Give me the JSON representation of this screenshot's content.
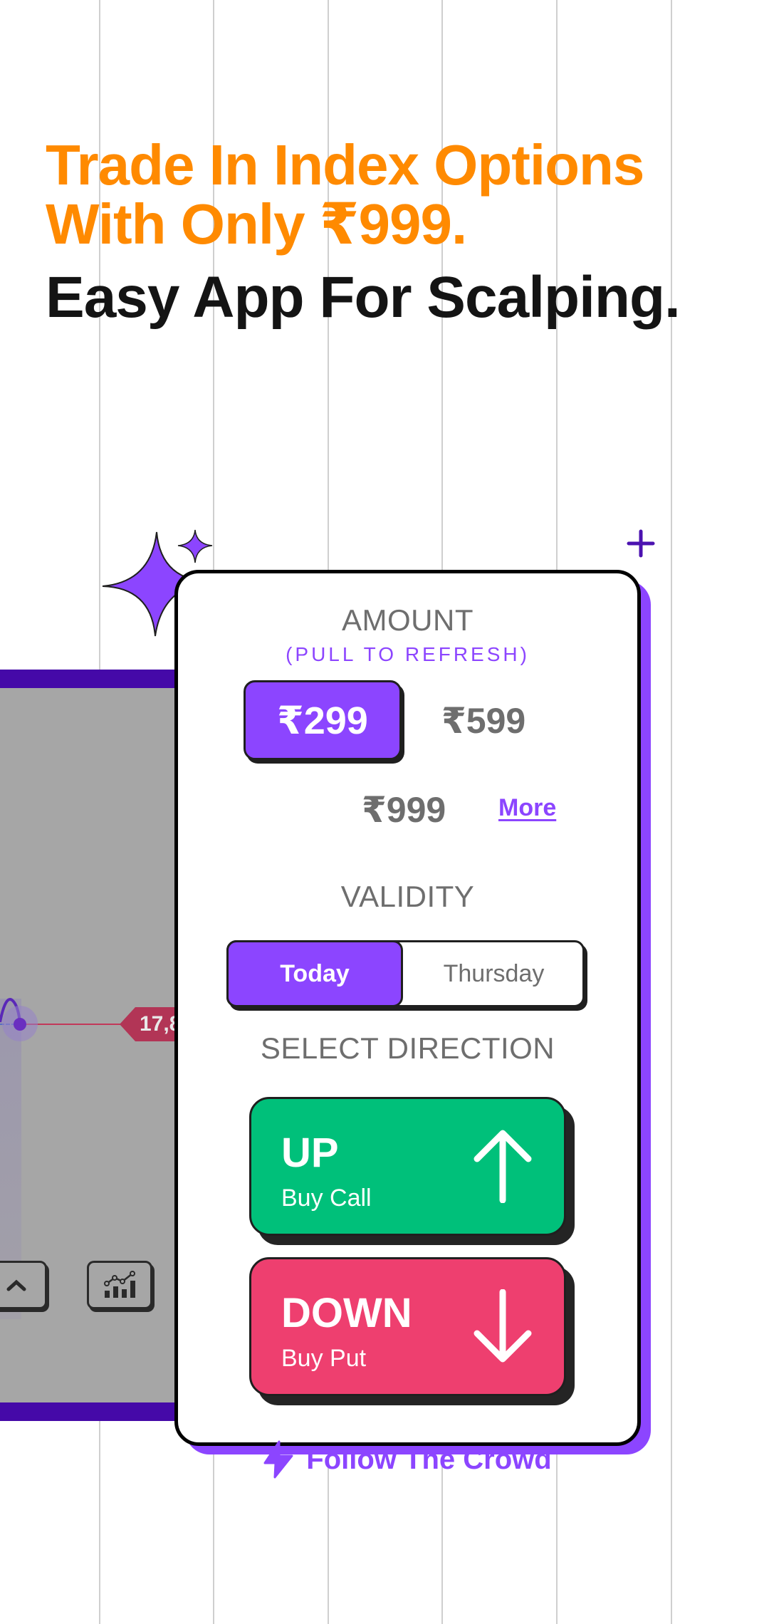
{
  "headline": {
    "line1": "Trade In Index Options",
    "line2": "With Only ₹999.",
    "line3": "Easy App For Scalping."
  },
  "background_chart": {
    "price_tag": "17,8",
    "buttons": [
      {
        "icon": "chevron-up-icon"
      },
      {
        "icon": "chart-icon"
      }
    ]
  },
  "card": {
    "amount": {
      "label": "AMOUNT",
      "hint": "(PULL TO REFRESH)",
      "options": [
        {
          "label": "₹299",
          "selected": true
        },
        {
          "label": "₹599",
          "selected": false
        },
        {
          "label": "₹999",
          "selected": false
        }
      ],
      "more_label": "More"
    },
    "validity": {
      "label": "VALIDITY",
      "options": [
        {
          "label": "Today",
          "selected": true
        },
        {
          "label": "Thursday",
          "selected": false
        }
      ]
    },
    "direction": {
      "label": "SELECT DIRECTION",
      "up": {
        "title": "UP",
        "subtitle": "Buy Call",
        "icon": "arrow-up-icon"
      },
      "down": {
        "title": "DOWN",
        "subtitle": "Buy Put",
        "icon": "arrow-down-icon"
      }
    },
    "follow_crowd": {
      "label": "Follow The Crowd",
      "icon": "lightning-icon"
    }
  },
  "colors": {
    "orange": "#ff8a00",
    "purple": "#8c45ff",
    "deep_purple": "#4509a8",
    "green": "#00c07a",
    "pink": "#ee3f6f"
  }
}
